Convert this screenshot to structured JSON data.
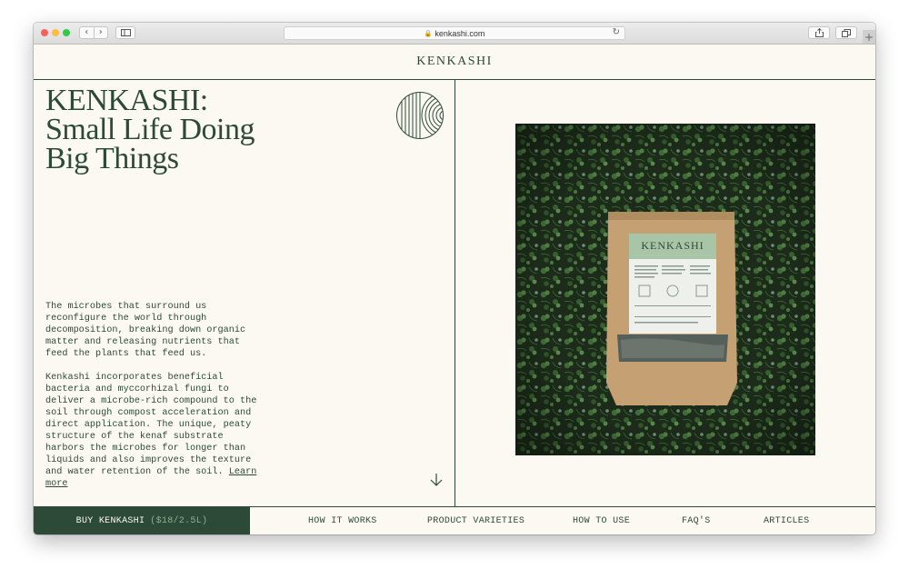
{
  "browser": {
    "url": "kenkashi.com",
    "nav_back_icon": "chevron-left-icon",
    "nav_forward_icon": "chevron-right-icon",
    "new_tab_label": "+"
  },
  "site": {
    "logo": "KENKASHI",
    "headline_line1": "KENKASHI:",
    "headline_line2": "Small Life Doing",
    "headline_line3": "Big Things",
    "paragraph1": "The microbes that surround us reconfigure the world through decomposition, breaking down organic matter and releasing nutrients that feed the plants that feed us.",
    "paragraph2": "Kenkashi incorporates beneficial bacteria and myccorhizal fungi to deliver a microbe-rich compound to the soil through compost acceleration and direct application. The unique, peaty structure of the kenaf substrate harbors the microbes for longer than liquids and also improves the texture and water retention of the soil.",
    "learn_more": "Learn more",
    "package_brand": "KENKASHI"
  },
  "bottom_nav": {
    "buy_label": "BUY KENKASHI",
    "buy_price": "($18/2.5L)",
    "items": [
      "HOW IT WORKS",
      "PRODUCT VARIETIES",
      "HOW TO USE",
      "FAQ'S",
      "ARTICLES"
    ]
  },
  "colors": {
    "brand_green": "#2d4a38",
    "background": "#fbf9f2",
    "price_green": "#8fae93"
  }
}
